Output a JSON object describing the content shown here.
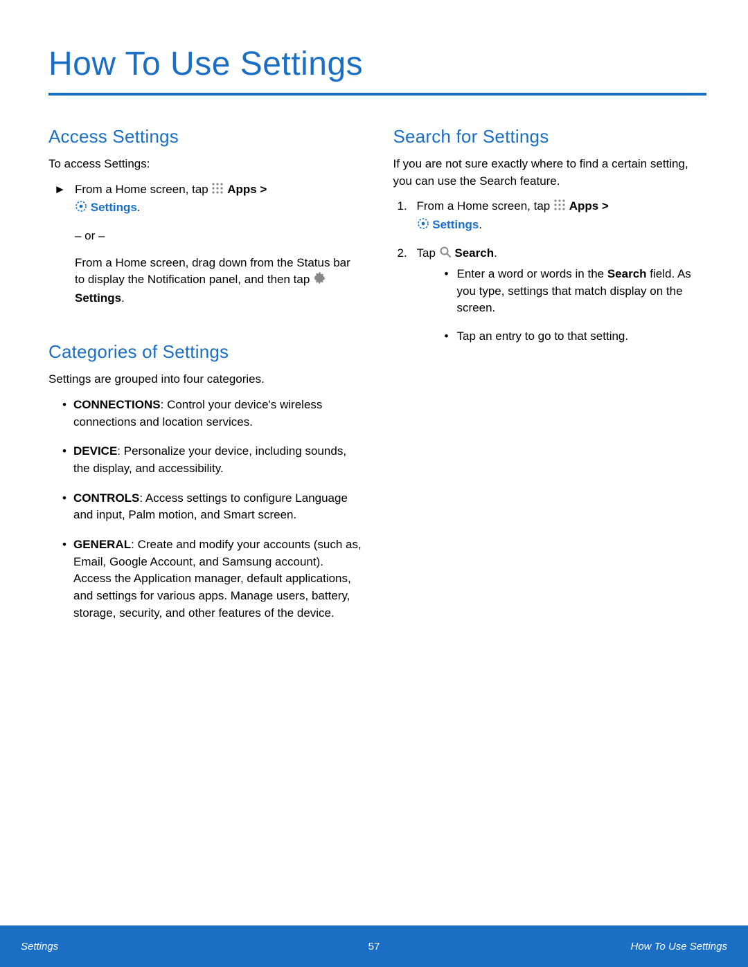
{
  "page": {
    "title": "How To Use Settings"
  },
  "left": {
    "access": {
      "heading": "Access Settings",
      "intro": "To access Settings:",
      "arrow": "►",
      "step_prefix": "From a Home screen, tap ",
      "apps_label": "Apps",
      "gt": " > ",
      "settings_label": "Settings",
      "period": ".",
      "or_line": "– or –",
      "alt_prefix": "From a Home screen, drag down from the Status bar to display the Notification panel, and then tap ",
      "alt_settings": "Settings"
    },
    "categories": {
      "heading": "Categories of Settings",
      "intro": "Settings are grouped into four categories.",
      "items": [
        {
          "label": "CONNECTIONS",
          "desc": ": Control your device's wireless connections and location services."
        },
        {
          "label": "DEVICE",
          "desc": ": Personalize your device, including sounds, the display, and accessibility."
        },
        {
          "label": "CONTROLS",
          "desc": ": Access settings to configure Language and input, Palm motion, and Smart screen."
        },
        {
          "label": "GENERAL",
          "desc": ": Create and modify your accounts (such as, Email, Google Account, and Samsung account). Access the Application manager, default applications, and settings for various apps. Manage users, battery, storage, security, and other features of the device."
        }
      ]
    }
  },
  "right": {
    "search": {
      "heading": "Search for Settings",
      "intro": "If you are not sure exactly where to find a certain setting, you can use the Search feature.",
      "step1_num": "1.",
      "step1_prefix": "From a Home screen, tap ",
      "apps_label": "Apps",
      "gt": " > ",
      "settings_label": "Settings",
      "period": ".",
      "step2_num": "2.",
      "step2_prefix": "Tap ",
      "search_label": "Search",
      "sub_a_pre": "Enter a word or words in the ",
      "sub_a_bold": "Search",
      "sub_a_post": " field. As you type, settings that match display on the screen.",
      "sub_b": "Tap an entry to go to that setting."
    }
  },
  "footer": {
    "left": "Settings",
    "page_number": "57",
    "right": "How To Use Settings"
  }
}
